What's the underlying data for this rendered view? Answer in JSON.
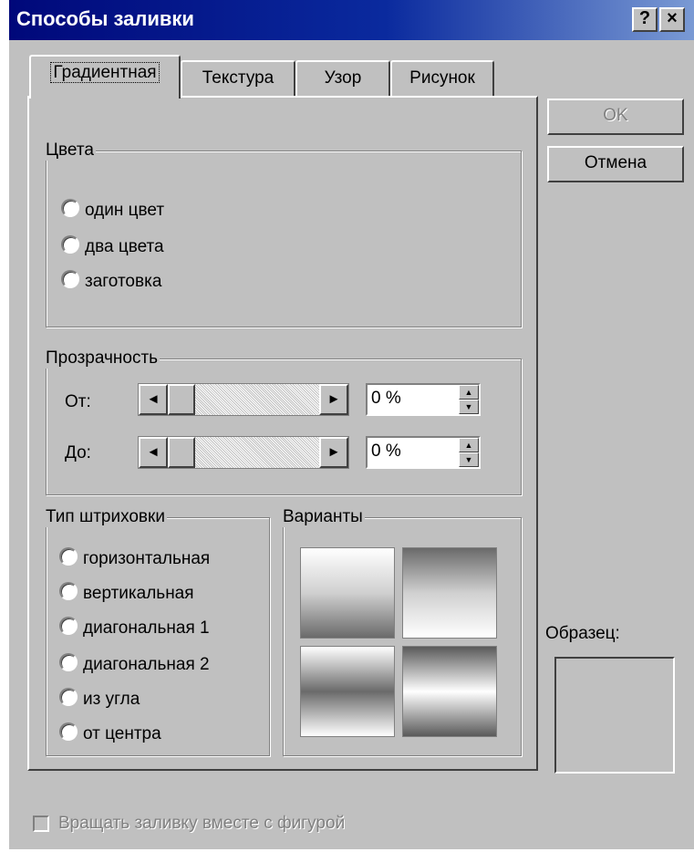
{
  "window": {
    "title": "Способы заливки",
    "help_label": "?",
    "close_label": "×"
  },
  "tabs": [
    {
      "label": "Градиентная",
      "active": true
    },
    {
      "label": "Текстура",
      "active": false
    },
    {
      "label": "Узор",
      "active": false
    },
    {
      "label": "Рисунок",
      "active": false
    }
  ],
  "colors_group": {
    "legend": "Цвета",
    "options": [
      "один цвет",
      "два цвета",
      "заготовка"
    ]
  },
  "transparency": {
    "legend": "Прозрачность",
    "from_label": "От:",
    "from_value": "0 %",
    "to_label": "До:",
    "to_value": "0 %"
  },
  "shading": {
    "legend": "Тип штриховки",
    "options": [
      "горизонтальная",
      "вертикальная",
      "диагональная 1",
      "диагональная 2",
      "из угла",
      "от центра"
    ]
  },
  "variants": {
    "legend": "Варианты"
  },
  "buttons": {
    "ok": "OK",
    "cancel": "Отмена"
  },
  "sample": {
    "label": "Образец:"
  },
  "rotate_checkbox": {
    "label": "Вращать заливку вместе с фигурой",
    "checked": false,
    "enabled": false
  },
  "arrows": {
    "left": "◄",
    "right": "►",
    "up": "▲",
    "down": "▼"
  }
}
